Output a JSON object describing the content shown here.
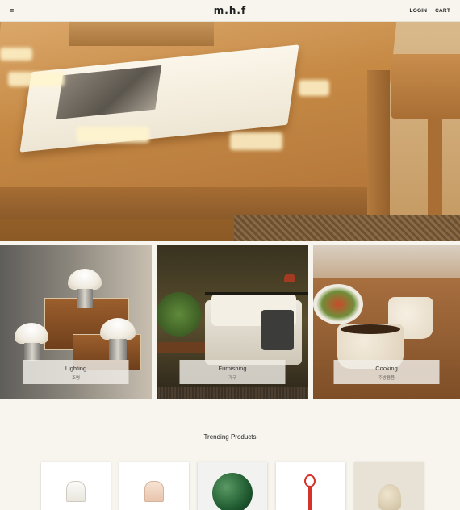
{
  "header": {
    "menu_icon": "hamburger-menu-icon",
    "logo": "m.h.f",
    "login_label": "LOGIN",
    "cart_label": "CART"
  },
  "categories": [
    {
      "title": "Lighting",
      "subtitle": "조명"
    },
    {
      "title": "Furnishing",
      "subtitle": "가구"
    },
    {
      "title": "Cooking",
      "subtitle": "주방용품"
    }
  ],
  "trending": {
    "title": "Trending Products",
    "items": [
      "glass-lamp-clear",
      "glass-lamp-amber",
      "green-globe",
      "red-pendant-lamp",
      "ceramic-vase"
    ]
  }
}
